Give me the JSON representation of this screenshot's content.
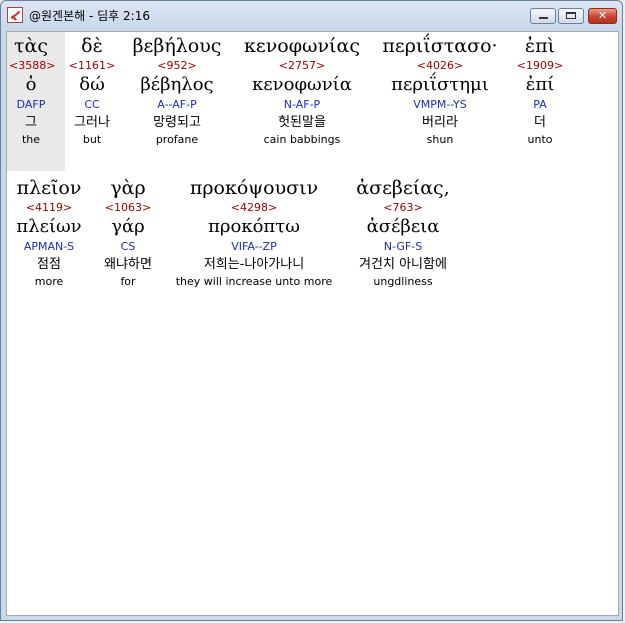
{
  "window": {
    "title": "@원겐본해 - 딤후 2:16",
    "minimize_label": "",
    "maximize_label": "",
    "close_label": "✕"
  },
  "lines": [
    {
      "words": [
        {
          "greek": "τὰς",
          "strong": "<3588>",
          "lexeme": "ὁ",
          "parse": "DAFP",
          "korean": "그",
          "english": "the",
          "selected": true
        },
        {
          "greek": "δὲ",
          "strong": "<1161>",
          "lexeme": "δώ",
          "parse": "CC",
          "korean": "그러나",
          "english": "but"
        },
        {
          "greek": "βεβήλους",
          "strong": "<952>",
          "lexeme": "βέβηλος",
          "parse": "A--AF-P",
          "korean": "망령되고",
          "english": "profane"
        },
        {
          "greek": "κενοφωνίας",
          "strong": "<2757>",
          "lexeme": "κενοφωνία",
          "parse": "N-AF-P",
          "korean": "헛된말을",
          "english": "cain babbings"
        },
        {
          "greek": "περιΐστασο·",
          "strong": "<4026>",
          "lexeme": "περιΐστημι",
          "parse": "VMPM--YS",
          "korean": "버리라",
          "english": "shun"
        },
        {
          "greek": "ἐπὶ",
          "strong": "<1909>",
          "lexeme": "ἐπί",
          "parse": "PA",
          "korean": "더",
          "english": "unto"
        }
      ]
    },
    {
      "words": [
        {
          "greek": "πλεῖον",
          "strong": "<4119>",
          "lexeme": "πλείων",
          "parse": "APMAN-S",
          "korean": "점점",
          "english": "more"
        },
        {
          "greek": "γὰρ",
          "strong": "<1063>",
          "lexeme": "γάρ",
          "parse": "CS",
          "korean": "왜냐하면",
          "english": "for"
        },
        {
          "greek": "προκόψουσιν",
          "strong": "<4298>",
          "lexeme": "προκόπτω",
          "parse": "VIFA--ZP",
          "korean": "저희는-나아가나니",
          "english": "they will increase unto more"
        },
        {
          "greek": "ἀσεβείας,",
          "strong": "<763>",
          "lexeme": "ἀσέβεια",
          "parse": "N-GF-S",
          "korean": "겨건치 아니함에",
          "english": "ungdliness"
        }
      ]
    }
  ]
}
